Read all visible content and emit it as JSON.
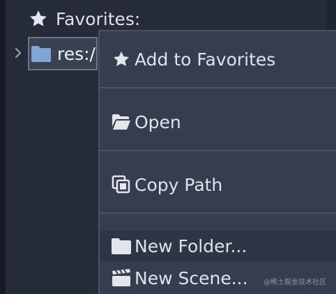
{
  "tree": {
    "favorites_label": "Favorites:",
    "root_label": "res:/"
  },
  "menu": {
    "items": [
      {
        "label": "Add to Favorites",
        "icon": "star-icon"
      },
      {
        "label": "Open",
        "icon": "folder-open-icon"
      },
      {
        "label": "Copy Path",
        "icon": "copy-icon"
      },
      {
        "label": "New Folder...",
        "icon": "folder-icon"
      },
      {
        "label": "New Scene...",
        "icon": "clapperboard-icon"
      }
    ]
  },
  "watermark": "@稀土掘金技术社区",
  "colors": {
    "background": "#252b38",
    "menu_background": "#353d4e",
    "folder_blue": "#7ea7d8",
    "text": "#dfe3ea"
  }
}
